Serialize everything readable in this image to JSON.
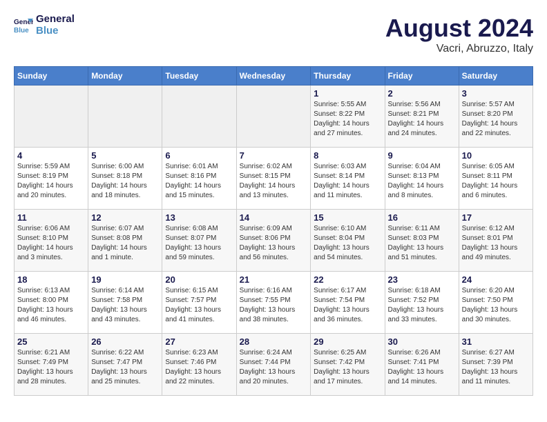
{
  "header": {
    "logo_line1": "General",
    "logo_line2": "Blue",
    "month": "August 2024",
    "location": "Vacri, Abruzzo, Italy"
  },
  "days_of_week": [
    "Sunday",
    "Monday",
    "Tuesday",
    "Wednesday",
    "Thursday",
    "Friday",
    "Saturday"
  ],
  "weeks": [
    [
      {
        "day": "",
        "info": ""
      },
      {
        "day": "",
        "info": ""
      },
      {
        "day": "",
        "info": ""
      },
      {
        "day": "",
        "info": ""
      },
      {
        "day": "1",
        "info": "Sunrise: 5:55 AM\nSunset: 8:22 PM\nDaylight: 14 hours\nand 27 minutes."
      },
      {
        "day": "2",
        "info": "Sunrise: 5:56 AM\nSunset: 8:21 PM\nDaylight: 14 hours\nand 24 minutes."
      },
      {
        "day": "3",
        "info": "Sunrise: 5:57 AM\nSunset: 8:20 PM\nDaylight: 14 hours\nand 22 minutes."
      }
    ],
    [
      {
        "day": "4",
        "info": "Sunrise: 5:59 AM\nSunset: 8:19 PM\nDaylight: 14 hours\nand 20 minutes."
      },
      {
        "day": "5",
        "info": "Sunrise: 6:00 AM\nSunset: 8:18 PM\nDaylight: 14 hours\nand 18 minutes."
      },
      {
        "day": "6",
        "info": "Sunrise: 6:01 AM\nSunset: 8:16 PM\nDaylight: 14 hours\nand 15 minutes."
      },
      {
        "day": "7",
        "info": "Sunrise: 6:02 AM\nSunset: 8:15 PM\nDaylight: 14 hours\nand 13 minutes."
      },
      {
        "day": "8",
        "info": "Sunrise: 6:03 AM\nSunset: 8:14 PM\nDaylight: 14 hours\nand 11 minutes."
      },
      {
        "day": "9",
        "info": "Sunrise: 6:04 AM\nSunset: 8:13 PM\nDaylight: 14 hours\nand 8 minutes."
      },
      {
        "day": "10",
        "info": "Sunrise: 6:05 AM\nSunset: 8:11 PM\nDaylight: 14 hours\nand 6 minutes."
      }
    ],
    [
      {
        "day": "11",
        "info": "Sunrise: 6:06 AM\nSunset: 8:10 PM\nDaylight: 14 hours\nand 3 minutes."
      },
      {
        "day": "12",
        "info": "Sunrise: 6:07 AM\nSunset: 8:08 PM\nDaylight: 14 hours\nand 1 minute."
      },
      {
        "day": "13",
        "info": "Sunrise: 6:08 AM\nSunset: 8:07 PM\nDaylight: 13 hours\nand 59 minutes."
      },
      {
        "day": "14",
        "info": "Sunrise: 6:09 AM\nSunset: 8:06 PM\nDaylight: 13 hours\nand 56 minutes."
      },
      {
        "day": "15",
        "info": "Sunrise: 6:10 AM\nSunset: 8:04 PM\nDaylight: 13 hours\nand 54 minutes."
      },
      {
        "day": "16",
        "info": "Sunrise: 6:11 AM\nSunset: 8:03 PM\nDaylight: 13 hours\nand 51 minutes."
      },
      {
        "day": "17",
        "info": "Sunrise: 6:12 AM\nSunset: 8:01 PM\nDaylight: 13 hours\nand 49 minutes."
      }
    ],
    [
      {
        "day": "18",
        "info": "Sunrise: 6:13 AM\nSunset: 8:00 PM\nDaylight: 13 hours\nand 46 minutes."
      },
      {
        "day": "19",
        "info": "Sunrise: 6:14 AM\nSunset: 7:58 PM\nDaylight: 13 hours\nand 43 minutes."
      },
      {
        "day": "20",
        "info": "Sunrise: 6:15 AM\nSunset: 7:57 PM\nDaylight: 13 hours\nand 41 minutes."
      },
      {
        "day": "21",
        "info": "Sunrise: 6:16 AM\nSunset: 7:55 PM\nDaylight: 13 hours\nand 38 minutes."
      },
      {
        "day": "22",
        "info": "Sunrise: 6:17 AM\nSunset: 7:54 PM\nDaylight: 13 hours\nand 36 minutes."
      },
      {
        "day": "23",
        "info": "Sunrise: 6:18 AM\nSunset: 7:52 PM\nDaylight: 13 hours\nand 33 minutes."
      },
      {
        "day": "24",
        "info": "Sunrise: 6:20 AM\nSunset: 7:50 PM\nDaylight: 13 hours\nand 30 minutes."
      }
    ],
    [
      {
        "day": "25",
        "info": "Sunrise: 6:21 AM\nSunset: 7:49 PM\nDaylight: 13 hours\nand 28 minutes."
      },
      {
        "day": "26",
        "info": "Sunrise: 6:22 AM\nSunset: 7:47 PM\nDaylight: 13 hours\nand 25 minutes."
      },
      {
        "day": "27",
        "info": "Sunrise: 6:23 AM\nSunset: 7:46 PM\nDaylight: 13 hours\nand 22 minutes."
      },
      {
        "day": "28",
        "info": "Sunrise: 6:24 AM\nSunset: 7:44 PM\nDaylight: 13 hours\nand 20 minutes."
      },
      {
        "day": "29",
        "info": "Sunrise: 6:25 AM\nSunset: 7:42 PM\nDaylight: 13 hours\nand 17 minutes."
      },
      {
        "day": "30",
        "info": "Sunrise: 6:26 AM\nSunset: 7:41 PM\nDaylight: 13 hours\nand 14 minutes."
      },
      {
        "day": "31",
        "info": "Sunrise: 6:27 AM\nSunset: 7:39 PM\nDaylight: 13 hours\nand 11 minutes."
      }
    ]
  ]
}
